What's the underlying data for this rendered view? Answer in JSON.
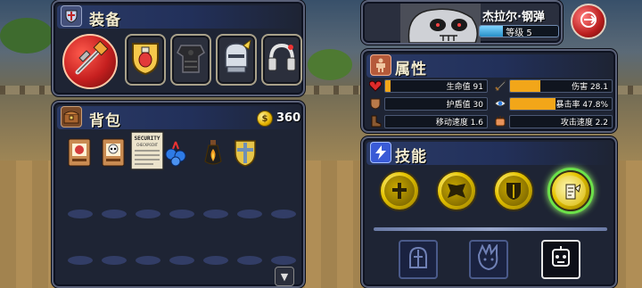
{
  "equipment": {
    "title": "装备",
    "icon": "shield-crest-icon",
    "slots": [
      {
        "name": "weapon-axe-icon"
      },
      {
        "name": "potion-shield-icon"
      },
      {
        "name": "dark-armor-icon"
      },
      {
        "name": "knight-helmet-icon"
      },
      {
        "name": "headphone-icon"
      }
    ]
  },
  "backpack": {
    "title": "背包",
    "icon": "chest-icon",
    "gold": "360",
    "items": [
      {
        "name": "scroll-card-red-icon"
      },
      {
        "name": "scroll-card-skull-icon"
      },
      {
        "name": "security-checkpoint-sign-icon",
        "text": "SECURITY CHECKPOINT"
      },
      {
        "name": "blue-fruit-icon"
      },
      {
        "name": "fire-flask-icon"
      },
      {
        "name": "cross-shield-icon"
      }
    ]
  },
  "hero": {
    "name": "杰拉尔·钢弹",
    "level_label": "等级 5",
    "level_progress": 0.3,
    "portrait": "skull-warrior-portrait"
  },
  "attributes": {
    "title": "属性",
    "icon": "body-figure-icon",
    "left": [
      {
        "icon": "heart-icon",
        "label": "生命值 91",
        "fill": 0.05
      },
      {
        "icon": "armor-icon",
        "label": "护盾值 30",
        "fill": 0.0
      },
      {
        "icon": "boot-icon",
        "label": "移动速度 1.6",
        "fill": 0.0
      }
    ],
    "right": [
      {
        "icon": "sword-icon",
        "label": "伤害 28.1",
        "fill": 0.3
      },
      {
        "icon": "eye-icon",
        "label": "暴击率 47.8%",
        "fill": 0.45
      },
      {
        "icon": "fist-icon",
        "label": "攻击速度 2.2",
        "fill": 0.0
      }
    ]
  },
  "skills": {
    "title": "技能",
    "icon": "lightning-icon",
    "active": [
      {
        "name": "cross-skill-icon",
        "glyph": "✝"
      },
      {
        "name": "wings-skill-icon",
        "glyph": "≋"
      },
      {
        "name": "shield-skill-icon",
        "glyph": "◈"
      },
      {
        "name": "winged-scroll-skill-icon",
        "glyph": "✎"
      }
    ],
    "passive": [
      {
        "name": "helmet-passive-icon"
      },
      {
        "name": "spiky-hair-passive-icon"
      },
      {
        "name": "robot-head-passive-icon"
      }
    ]
  },
  "colors": {
    "panel_bg": "#1e2434",
    "stat_fill": "#f2a619",
    "active_glow": "#6be24a"
  }
}
